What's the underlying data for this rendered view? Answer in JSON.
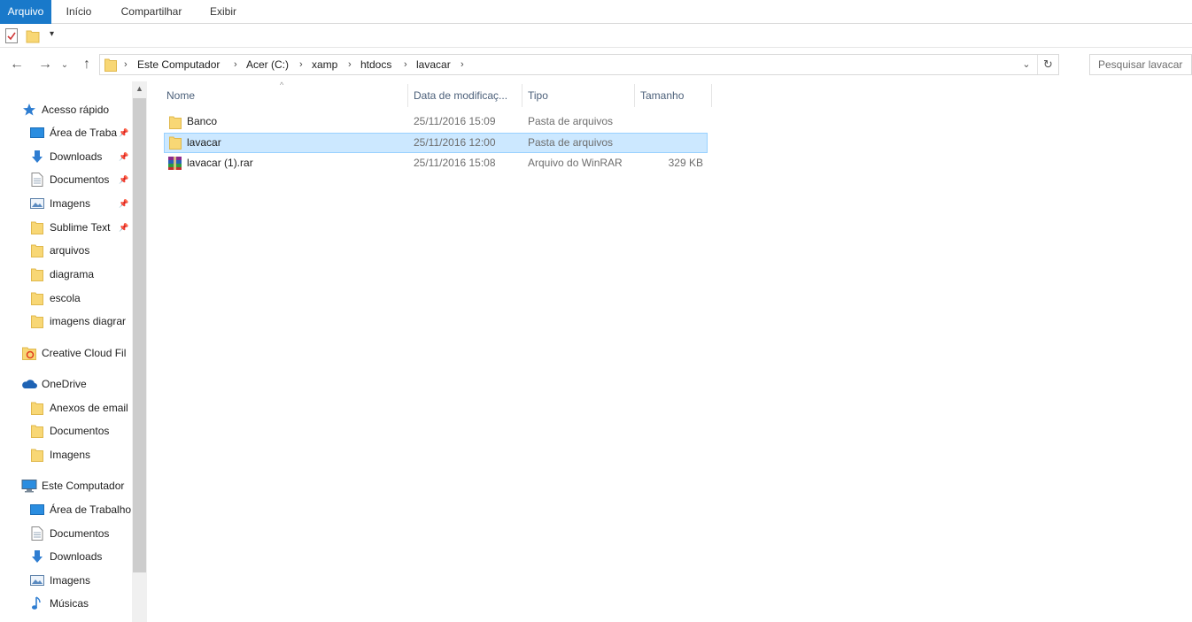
{
  "ribbon": {
    "tabs": [
      {
        "label": "Arquivo",
        "active": true
      },
      {
        "label": "Início",
        "active": false
      },
      {
        "label": "Compartilhar",
        "active": false
      },
      {
        "label": "Exibir",
        "active": false
      }
    ]
  },
  "quick_access_toolbar": {
    "items": [
      "properties-icon",
      "new-folder-icon",
      "customize-dropdown-icon"
    ]
  },
  "navigation": {
    "back_icon": "arrow-left-icon",
    "forward_icon": "arrow-right-icon",
    "recent_icon": "chevron-down-icon",
    "up_icon": "arrow-up-icon"
  },
  "address_bar": {
    "crumbs": [
      "Este Computador",
      "Acer (C:)",
      "xamp",
      "htdocs",
      "lavacar"
    ]
  },
  "search": {
    "placeholder": "Pesquisar lavacar"
  },
  "sidebar": {
    "items": [
      {
        "label": "Acesso rápido",
        "icon": "star-icon",
        "pinned": false
      },
      {
        "label": "Área de Traba",
        "icon": "desktop-icon",
        "pinned": true
      },
      {
        "label": "Downloads",
        "icon": "download-icon",
        "pinned": true
      },
      {
        "label": "Documentos",
        "icon": "document-icon",
        "pinned": true
      },
      {
        "label": "Imagens",
        "icon": "pictures-icon",
        "pinned": true
      },
      {
        "label": "Sublime Text",
        "icon": "folder-icon",
        "pinned": true
      },
      {
        "label": "arquivos",
        "icon": "folder-icon",
        "pinned": false
      },
      {
        "label": "diagrama",
        "icon": "folder-icon",
        "pinned": false
      },
      {
        "label": "escola",
        "icon": "folder-icon",
        "pinned": false
      },
      {
        "label": "imagens diagrar",
        "icon": "folder-icon",
        "pinned": false
      },
      {
        "label": "Creative Cloud Fil",
        "icon": "creative-cloud-icon",
        "pinned": false
      },
      {
        "label": "OneDrive",
        "icon": "cloud-icon",
        "pinned": false
      },
      {
        "label": "Anexos de email",
        "icon": "folder-icon",
        "pinned": false
      },
      {
        "label": "Documentos",
        "icon": "folder-icon",
        "pinned": false
      },
      {
        "label": "Imagens",
        "icon": "folder-icon",
        "pinned": false
      },
      {
        "label": "Este Computador",
        "icon": "computer-icon",
        "pinned": false
      },
      {
        "label": "Área de Trabalho",
        "icon": "desktop-icon",
        "pinned": false
      },
      {
        "label": "Documentos",
        "icon": "document-icon",
        "pinned": false
      },
      {
        "label": "Downloads",
        "icon": "download-icon",
        "pinned": false
      },
      {
        "label": "Imagens",
        "icon": "pictures-icon",
        "pinned": false
      },
      {
        "label": "Músicas",
        "icon": "music-icon",
        "pinned": false
      }
    ]
  },
  "file_list": {
    "columns": [
      "Nome",
      "Data de modificaç...",
      "Tipo",
      "Tamanho"
    ],
    "rows": [
      {
        "name": "Banco",
        "modified": "25/11/2016 15:09",
        "type": "Pasta de arquivos",
        "size": "",
        "icon": "folder-icon",
        "selected": false
      },
      {
        "name": "lavacar",
        "modified": "25/11/2016 12:00",
        "type": "Pasta de arquivos",
        "size": "",
        "icon": "folder-icon",
        "selected": true
      },
      {
        "name": "lavacar (1).rar",
        "modified": "25/11/2016 15:08",
        "type": "Arquivo do WinRAR",
        "size": "329 KB",
        "icon": "winrar-archive-icon",
        "selected": false
      }
    ]
  },
  "colors": {
    "accent": "#1979ca",
    "selection": "#cce8ff",
    "selection_border": "#99d1ff",
    "folder": "#f8d775",
    "header_text": "#4c607a"
  }
}
